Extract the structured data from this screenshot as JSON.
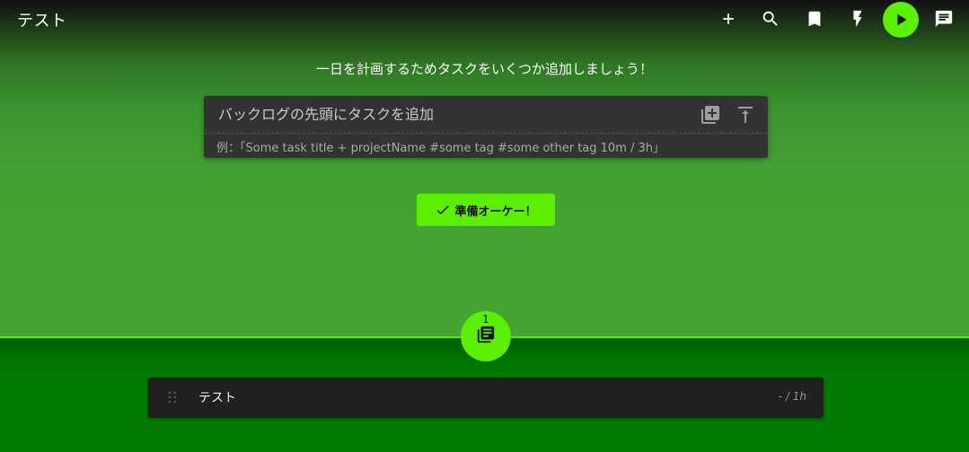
{
  "header": {
    "title": "テスト",
    "icons": [
      "add-icon",
      "search-icon",
      "bookmark-icon",
      "flash-icon",
      "play-icon",
      "chat-icon"
    ],
    "accent_color": "#5cf000"
  },
  "planning": {
    "prompt": "一日を計画するためタスクをいくつか追加しましょう！",
    "add_task": {
      "placeholder": "バックログの先頭にタスクを追加",
      "value": "",
      "hint": "例：「Some task title + projectName #some tag #some other tag 10m / 3h」",
      "icons": [
        "library-add-icon",
        "vertical-align-top-icon"
      ]
    },
    "ready_button_label": "準備オーケー！"
  },
  "backlog": {
    "count": "1",
    "icon": "backlog-icon",
    "tasks": [
      {
        "title": "テスト",
        "time": "- / 1h"
      }
    ]
  },
  "colors": {
    "top_background": "#46a433",
    "bottom_background": "#007a00",
    "card_background": "#333333",
    "task_background": "#202020"
  }
}
